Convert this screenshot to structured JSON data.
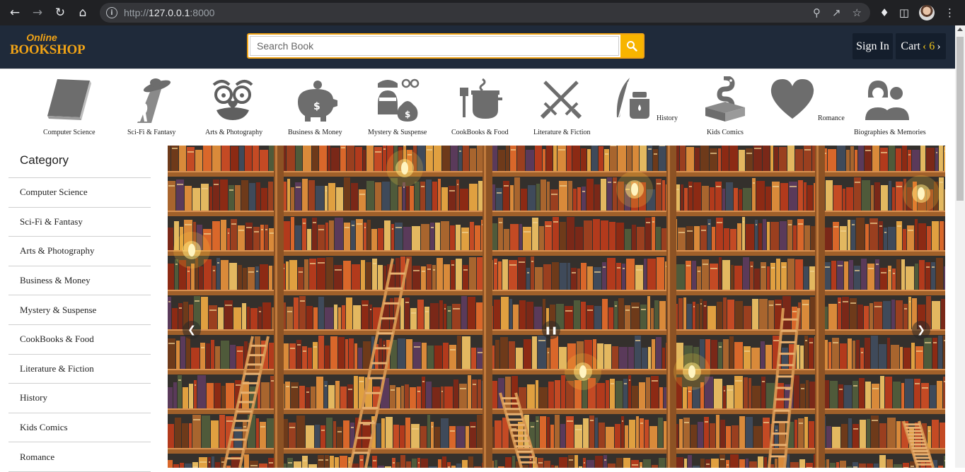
{
  "browser": {
    "url_scheme": "http://",
    "url_host": "127.0.0.1",
    "url_port": ":8000"
  },
  "header": {
    "logo_line1": "Online",
    "logo_line2": "BOOKSHOP",
    "search_placeholder": "Search Book",
    "signin_label": "Sign In",
    "cart_label": "Cart",
    "cart_count": "6",
    "accent_color": "#f0a316",
    "bg_color": "#1f2a3a"
  },
  "categories_strip": [
    {
      "label": "Computer Science",
      "icon": "book-icon"
    },
    {
      "label": "Sci-Fi & Fantasy",
      "icon": "ufo-icon"
    },
    {
      "label": "Arts & Photography",
      "icon": "disguise-mask-icon"
    },
    {
      "label": "Business & Money",
      "icon": "piggy-bank-icon"
    },
    {
      "label": "Mystery & Suspense",
      "icon": "thief-icon"
    },
    {
      "label": "CookBooks & Food",
      "icon": "cooking-pot-icon"
    },
    {
      "label": "Literature & Fiction",
      "icon": "crossed-swords-icon"
    },
    {
      "label": "History",
      "icon": "quill-inkwell-icon"
    },
    {
      "label": "Kids Comics",
      "icon": "snake-box-icon"
    },
    {
      "label": "Romance",
      "icon": "heart-icon"
    },
    {
      "label": "Biographies & Memories",
      "icon": "people-icon"
    }
  ],
  "sidebar": {
    "title": "Category",
    "items": [
      "Computer Science",
      "Sci-Fi & Fantasy",
      "Arts & Photography",
      "Business & Money",
      "Mystery & Suspense",
      "CookBooks & Food",
      "Literature & Fiction",
      "History",
      "Kids Comics",
      "Romance"
    ]
  },
  "carousel": {
    "image": "library-bookshelves-with-ladders",
    "prev_icon": "chevron-left-icon",
    "pause_icon": "pause-icon",
    "next_icon": "chevron-right-icon"
  }
}
